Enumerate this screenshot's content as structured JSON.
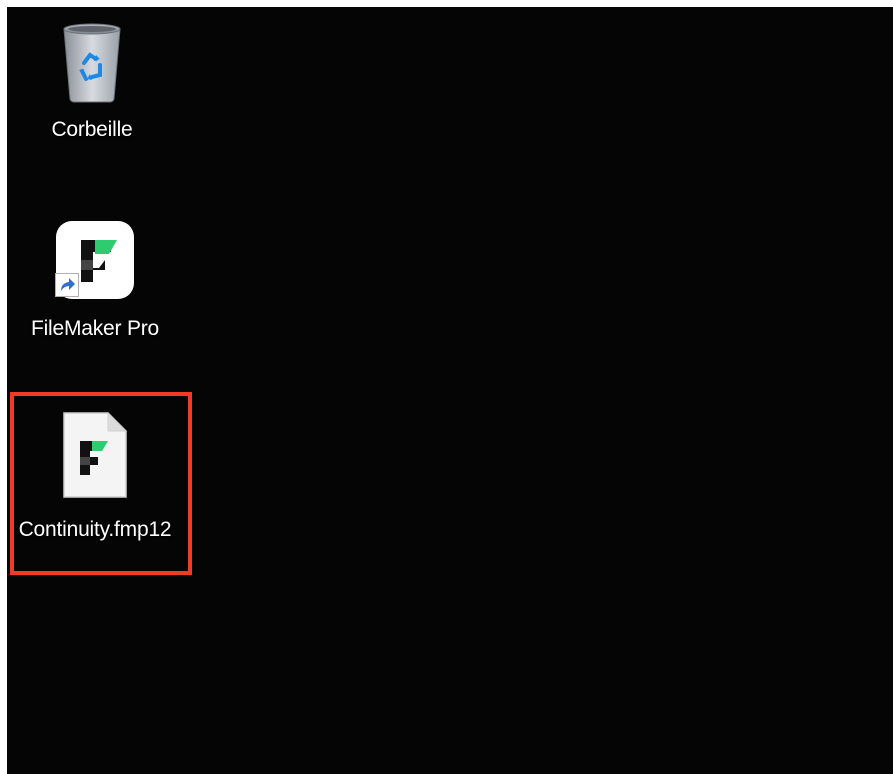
{
  "desktop": {
    "background_color": "#050505",
    "icons": [
      {
        "label": "Corbeille",
        "icon": "recycle-bin-icon"
      },
      {
        "label": "FileMaker Pro",
        "icon": "filemaker-app-icon",
        "shortcut": true
      },
      {
        "label": "Continuity.fmp12",
        "icon": "filemaker-document-icon",
        "highlighted": true
      }
    ],
    "highlight_color": "#f23a24"
  }
}
